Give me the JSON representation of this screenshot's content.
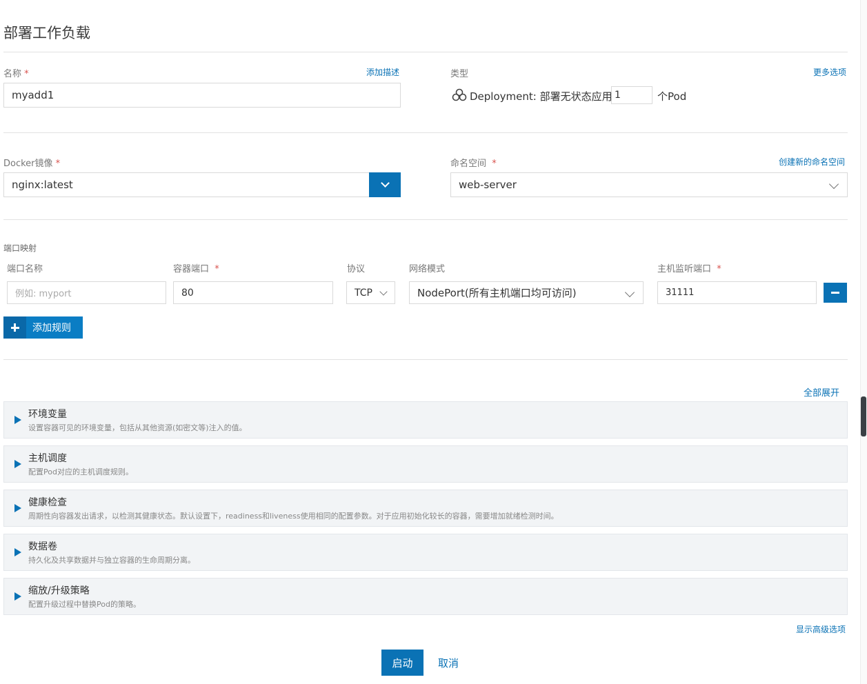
{
  "page": {
    "title": "部署工作负载"
  },
  "name": {
    "label": "名称",
    "required": "*",
    "add_desc": "添加描述",
    "value": "myadd1"
  },
  "type": {
    "label": "类型",
    "more_options": "更多选项",
    "deployment": "Deployment:",
    "desc": "部署无状态应用",
    "replicas": "1",
    "unit": "个Pod"
  },
  "docker": {
    "label": "Docker镜像",
    "required": "*",
    "value": "nginx:latest"
  },
  "namespace": {
    "label": "命名空间",
    "required": "*",
    "create_link": "创建新的命名空间",
    "value": "web-server"
  },
  "ports": {
    "section_label": "端口映射",
    "headers": {
      "port_name": "端口名称",
      "container_port": "容器端口",
      "protocol": "协议",
      "network_mode": "网络模式",
      "host_port": "主机监听端口"
    },
    "required": "*",
    "row": {
      "port_name_placeholder": "例如: myport",
      "container_port": "80",
      "protocol": "TCP",
      "network_mode": "NodePort(所有主机端口均可访问)",
      "host_port": "31111"
    },
    "add_rule": "添加规则"
  },
  "expand_all": "全部展开",
  "sections": [
    {
      "title": "环境变量",
      "desc": "设置容器可见的环境变量，包括从其他资源(如密文等)注入的值。"
    },
    {
      "title": "主机调度",
      "desc": "配置Pod对应的主机调度规则。"
    },
    {
      "title": "健康检查",
      "desc": "周期性向容器发出请求，以检测其健康状态。默认设置下，readiness和liveness使用相同的配置参数。对于应用初始化较长的容器，需要增加就绪检测时间。"
    },
    {
      "title": "数据卷",
      "desc": "持久化及共享数据并与独立容器的生命周期分离。"
    },
    {
      "title": "缩放/升级策略",
      "desc": "配置升级过程中替换Pod的策略。"
    }
  ],
  "advanced": "显示高级选项",
  "actions": {
    "launch": "启动",
    "cancel": "取消"
  },
  "colors": {
    "accent": "#0a72b5",
    "required": "#d9534f"
  }
}
